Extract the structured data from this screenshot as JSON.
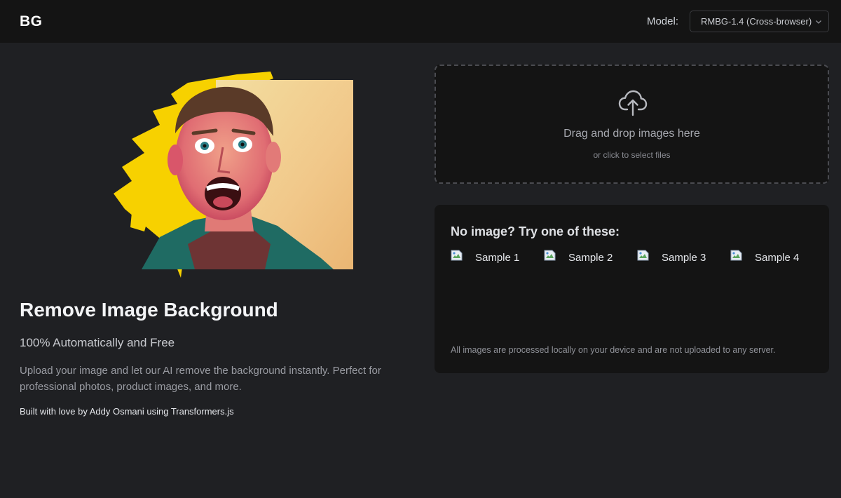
{
  "header": {
    "logo": "BG",
    "model_label": "Model:",
    "model_selected": "RMBG-1.4 (Cross-browser)"
  },
  "hero": {
    "title": "Remove Image Background",
    "subtitle": "100% Automatically and Free",
    "description": "Upload your image and let our AI remove the background instantly. Perfect for professional photos, product images, and more.",
    "credit": "Built with love by Addy Osmani using Transformers.js"
  },
  "dropzone": {
    "primary": "Drag and drop images here",
    "secondary": "or click to select files"
  },
  "samples": {
    "title": "No image? Try one of these:",
    "items": [
      {
        "label": "Sample 1"
      },
      {
        "label": "Sample 2"
      },
      {
        "label": "Sample 3"
      },
      {
        "label": "Sample 4"
      }
    ],
    "privacy_note": "All images are processed locally on your device and are not uploaded to any server."
  },
  "colors": {
    "background": "#1f2023",
    "surface": "#141414",
    "accent_yellow": "#f7d100"
  }
}
